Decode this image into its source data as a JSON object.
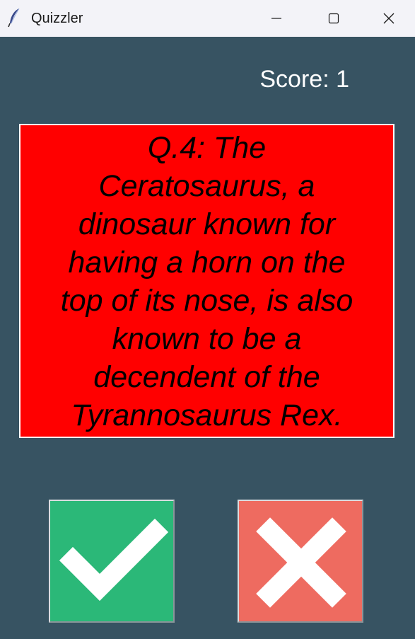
{
  "window": {
    "title": "Quizzler",
    "icon": "feather-icon",
    "controls": [
      "minimize-icon",
      "maximize-icon",
      "close-icon"
    ]
  },
  "score": {
    "label": "Score: 1"
  },
  "question": {
    "lines": [
      "Q.4: The",
      "Ceratosaurus, a",
      "dinosaur known for",
      "having a horn on the",
      "top of its nose, is also",
      "known to be a",
      "decendent of the",
      "Tyrannosaurus Rex."
    ]
  },
  "buttons": {
    "true_icon": "checkmark-icon",
    "false_icon": "cross-icon"
  },
  "colors": {
    "background": "#375362",
    "question_card": "#ff0000",
    "true_button": "#2bb878",
    "false_button": "#ee6b60"
  }
}
